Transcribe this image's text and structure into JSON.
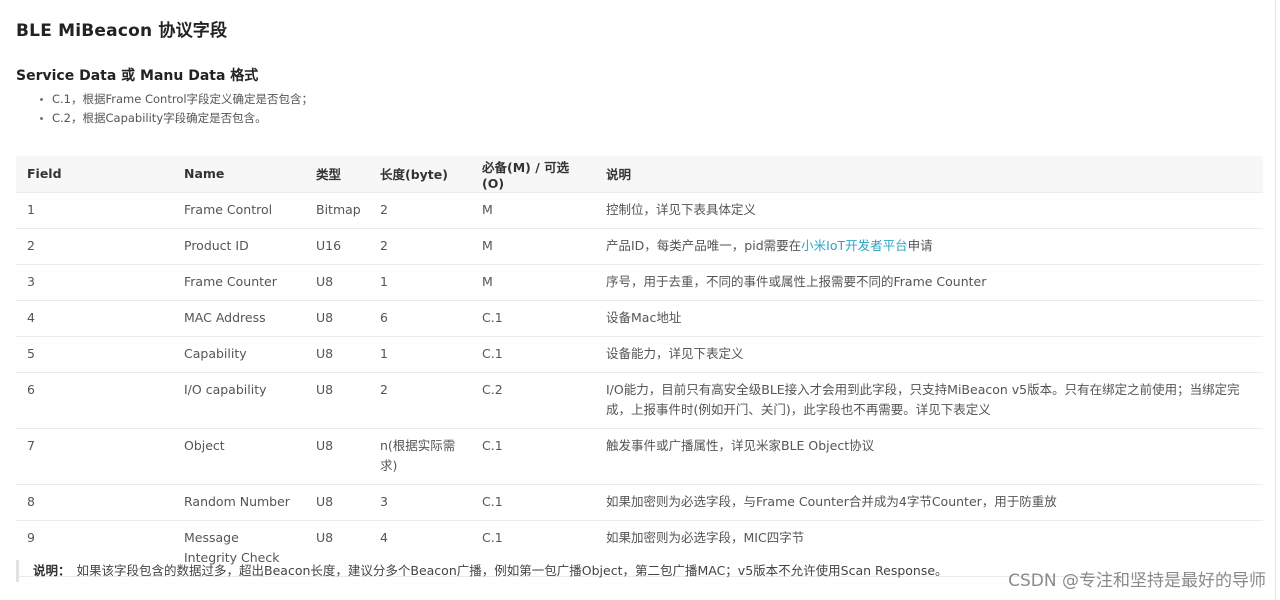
{
  "doc": {
    "title": "BLE MiBeacon 协议字段",
    "subtitle": "Service Data 或 Manu Data 格式",
    "notes": [
      "C.1，根据Frame Control字段定义确定是否包含；",
      "C.2，根据Capability字段确定是否包含。"
    ]
  },
  "table": {
    "headers": [
      "Field",
      "Name",
      "类型",
      "长度(byte)",
      "必备(M) / 可选(O)",
      "说明"
    ],
    "rows": [
      {
        "field": "1",
        "name": "Frame Control",
        "type": "Bitmap",
        "length": "2",
        "req": "M",
        "desc": "控制位，详见下表具体定义"
      },
      {
        "field": "2",
        "name": "Product ID",
        "type": "U16",
        "length": "2",
        "req": "M",
        "desc_pre": "产品ID，每类产品唯一，pid需要在",
        "desc_link": "小米IoT开发者平台",
        "desc_post": "申请"
      },
      {
        "field": "3",
        "name": "Frame Counter",
        "type": "U8",
        "length": "1",
        "req": "M",
        "desc": "序号，用于去重，不同的事件或属性上报需要不同的Frame Counter"
      },
      {
        "field": "4",
        "name": "MAC Address",
        "type": "U8",
        "length": "6",
        "req": "C.1",
        "desc": "设备Mac地址"
      },
      {
        "field": "5",
        "name": "Capability",
        "type": "U8",
        "length": "1",
        "req": "C.1",
        "desc": "设备能力，详见下表定义"
      },
      {
        "field": "6",
        "name": "I/O capability",
        "type": "U8",
        "length": "2",
        "req": "C.2",
        "desc": "I/O能力，目前只有高安全级BLE接入才会用到此字段，只支持MiBeacon v5版本。只有在绑定之前使用；当绑定完成，上报事件时(例如开门、关门)，此字段也不再需要。详见下表定义"
      },
      {
        "field": "7",
        "name": "Object",
        "type": "U8",
        "length": "n(根据实际需求)",
        "req": "C.1",
        "desc": "触发事件或广播属性，详见米家BLE Object协议"
      },
      {
        "field": "8",
        "name": "Random Number",
        "type": "U8",
        "length": "3",
        "req": "C.1",
        "desc": "如果加密则为必选字段，与Frame Counter合并成为4字节Counter，用于防重放"
      },
      {
        "field": "9",
        "name": "Message Integrity Check",
        "type": "U8",
        "length": "4",
        "req": "C.1",
        "desc": "如果加密则为必选字段，MIC四字节"
      }
    ]
  },
  "footnote": {
    "label": "说明：",
    "text": "如果该字段包含的数据过多，超出Beacon长度，建议分多个Beacon广播，例如第一包广播Object，第二包广播MAC；v5版本不允许使用Scan Response。"
  },
  "watermark": "CSDN @专注和坚持是最好的导师",
  "colors": {
    "link": "#2ba6c5",
    "header_bg": "#f7f7f7"
  }
}
